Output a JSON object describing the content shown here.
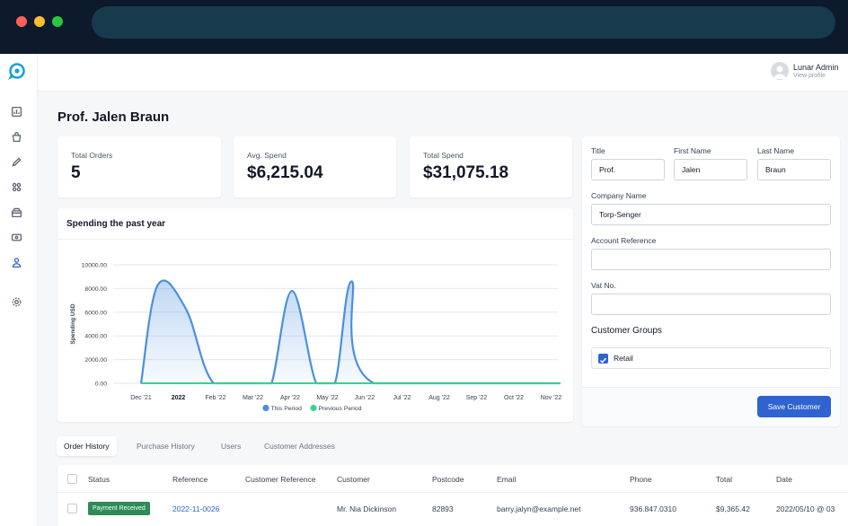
{
  "profile": {
    "name": "Lunar Admin",
    "subtitle": "View profile"
  },
  "page": {
    "title": "Prof. Jalen Braun"
  },
  "stats": [
    {
      "label": "Total Orders",
      "value": "5"
    },
    {
      "label": "Avg. Spend",
      "value": "$6,215.04"
    },
    {
      "label": "Total Spend",
      "value": "$31,075.18"
    }
  ],
  "chart_title": "Spending the past year",
  "chart_data": {
    "type": "area",
    "ylabel": "Spending USD",
    "ylim": [
      0,
      10000
    ],
    "yticks": [
      "10000.00",
      "8000.00",
      "6000.00",
      "4000.00",
      "2000.00",
      "0.00"
    ],
    "ytick_values": [
      10000,
      8000,
      6000,
      4000,
      2000,
      0
    ],
    "categories": [
      "Dec '21",
      "2022",
      "Feb '22",
      "Mar '22",
      "Apr '22",
      "May '22",
      "Jun '22",
      "Jul '22",
      "Aug '22",
      "Sep '22",
      "Oct '22",
      "Nov '22"
    ],
    "bold_categories": [
      "2022"
    ],
    "series": [
      {
        "name": "This Period",
        "color": "#4a8fe0",
        "points": [
          {
            "x": 0,
            "y": 0
          },
          {
            "x": 0.45,
            "y": 8300
          },
          {
            "x": 1.2,
            "y": 6300
          },
          {
            "x": 1.95,
            "y": 0
          },
          {
            "x": 3.1,
            "y": 0
          },
          {
            "x": 3.5,
            "y": 0
          },
          {
            "x": 4.05,
            "y": 7800
          },
          {
            "x": 4.7,
            "y": 0
          },
          {
            "x": 5.2,
            "y": 0
          },
          {
            "x": 5.65,
            "y": 8600
          },
          {
            "x": 6.25,
            "y": 0
          },
          {
            "x": 11.25,
            "y": 0
          }
        ]
      },
      {
        "name": "Previous Period",
        "color": "#3ccf91",
        "points": [
          {
            "x": 0,
            "y": 0
          },
          {
            "x": 11.25,
            "y": 0
          }
        ]
      }
    ],
    "legend": [
      "This Period",
      "Previous Period"
    ]
  },
  "form": {
    "title_label": "Title",
    "title_value": "Prof.",
    "first_name_label": "First Name",
    "first_name_value": "Jalen",
    "last_name_label": "Last Name",
    "last_name_value": "Braun",
    "company_label": "Company Name",
    "company_value": "Torp-Senger",
    "account_ref_label": "Account Reference",
    "account_ref_value": "",
    "vat_label": "Vat No.",
    "vat_value": "",
    "groups_title": "Customer Groups",
    "group_retail": "Retail",
    "save_label": "Save Customer"
  },
  "tabs": [
    "Order History",
    "Purchase History",
    "Users",
    "Customer Addresses"
  ],
  "table": {
    "headers": [
      "Status",
      "Reference",
      "Customer Reference",
      "Customer",
      "Postcode",
      "Email",
      "Phone",
      "Total",
      "Date"
    ],
    "rows": [
      [
        "Payment Received",
        "2022-11-0026",
        "",
        "Mr. Nia Dickinson",
        "82893",
        "barry.jalyn@example.net",
        "936.847.0310",
        "$9,365.42",
        "2022/05/10 @ 03"
      ]
    ]
  },
  "colors": {
    "accent": "#2e63d1",
    "badge": "#2e8b57",
    "chrome": "#0c1a2b"
  }
}
